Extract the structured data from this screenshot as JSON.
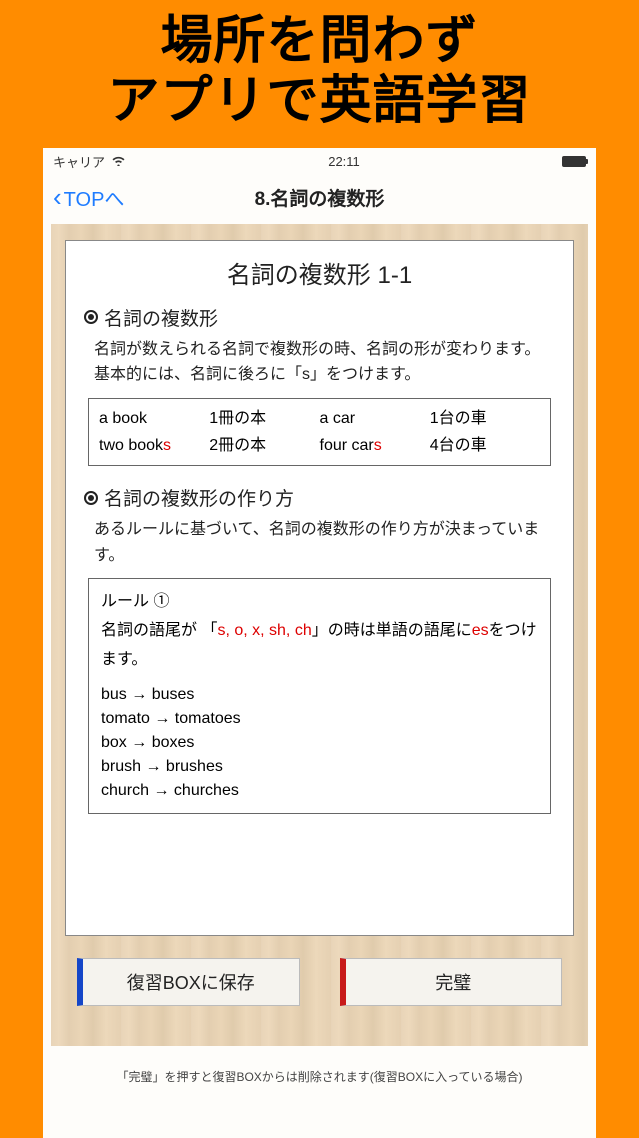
{
  "promo": {
    "line1": "場所を問わず",
    "line2": "アプリで英語学習"
  },
  "status": {
    "carrier": "キャリア",
    "time": "22:11"
  },
  "nav": {
    "back": "TOPへ",
    "title": "8.名詞の複数形"
  },
  "card": {
    "title": "名詞の複数形 1-1",
    "section1": {
      "head": "名詞の複数形",
      "body": "名詞が数えられる名詞で複数形の時、名詞の形が変わります。基本的には、名詞に後ろに「s」をつけます。"
    },
    "table": {
      "r1c1": "a book",
      "r1c2": "1冊の本",
      "r1c3": "a car",
      "r1c4": "1台の車",
      "r2c1a": "two book",
      "r2c1b": "s",
      "r2c2": "2冊の本",
      "r2c3a": "four car",
      "r2c3b": "s",
      "r2c4": "4台の車"
    },
    "section2": {
      "head": "名詞の複数形の作り方",
      "body": "あるルールに基づいて、名詞の複数形の作り方が決まっています。"
    },
    "rule": {
      "label": "ルール ①",
      "t1": "名詞の語尾が 「",
      "t2": "s, o, x, sh, ch",
      "t3": "」の時は単語の語尾に",
      "t4": "es",
      "t5": "をつけます。",
      "examples": [
        "bus → buses",
        "tomato → tomatoes",
        "box → boxes",
        "brush → brushes",
        "church → churches"
      ]
    }
  },
  "buttons": {
    "save": "復習BOXに保存",
    "done": "完璧"
  },
  "hint": "「完璧」を押すと復習BOXからは削除されます(復習BOXに入っている場合)"
}
